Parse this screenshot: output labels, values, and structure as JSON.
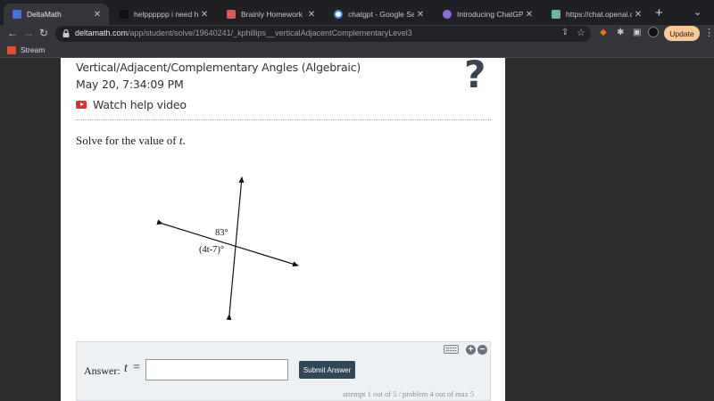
{
  "browser": {
    "tabs": [
      {
        "title": "DeltaMath",
        "active": true,
        "favicon": "deltamath-icon",
        "color": "#4a6fd8"
      },
      {
        "title": "helpppppp i need help -",
        "active": false,
        "favicon": "brainly-icon",
        "color": "#111111"
      },
      {
        "title": "Brainly Homework Help -",
        "active": false,
        "favicon": "brainly-icon",
        "color": "#d65a5a"
      },
      {
        "title": "chatgpt - Google Search",
        "active": false,
        "favicon": "google-icon",
        "color": "#4285f4"
      },
      {
        "title": "Introducing ChatGPT",
        "active": false,
        "favicon": "openai-icon",
        "color": "#8e6bd1"
      },
      {
        "title": "https://chat.openai.com",
        "active": false,
        "favicon": "openai-icon",
        "color": "#6fb59a"
      }
    ],
    "url_domain": "deltamath.com",
    "url_path": "/app/student/solve/19640241/_kphillips__verticalAdjacentComplementaryLevel3",
    "update_label": "Update",
    "bookmarks": [
      {
        "label": "Stream"
      }
    ]
  },
  "assignment": {
    "title": "Vertical/Adjacent/Complementary Angles (Algebraic)",
    "timestamp": "May 20, 7:34:09 PM",
    "help_video_label": "Watch help video",
    "help_icon": "?"
  },
  "problem": {
    "prompt_prefix": "Solve for the value of ",
    "variable": "t",
    "prompt_suffix": ".",
    "angle_label_1": "83°",
    "angle_label_2": "(4t-7)°"
  },
  "answer": {
    "label": "Answer:",
    "variable": "t",
    "equals": "=",
    "value": "",
    "submit_label": "Submit Answer",
    "attempt_text": "attempt 1 out of 5 / problem 4 out of max 5"
  }
}
